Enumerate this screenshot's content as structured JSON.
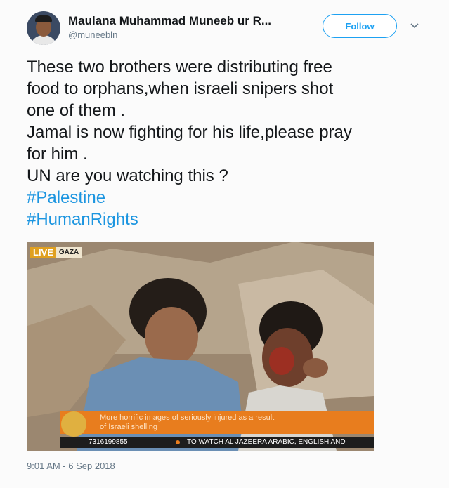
{
  "tweet": {
    "author_name": "Maulana Muhammad Muneeb ur R...",
    "handle": "@muneebln",
    "follow_label": "Follow",
    "lines": [
      "These two brothers were distributing free",
      "food to orphans,when israeli snipers shot",
      "one of them .",
      "Jamal is now fighting for his life,please pray",
      "for him .",
      "UN are you watching this ?"
    ],
    "hashtags": [
      "#Palestine",
      "#HumanRights"
    ],
    "timestamp": "9:01 AM - 6 Sep 2018"
  },
  "media": {
    "live_label": "LIVE",
    "location_label": "GAZA",
    "ticker_lines": [
      "More horrific images of seriously injured as a result",
      "of Israeli shelling"
    ],
    "phone_number": "7316199855",
    "bottom_message": "TO WATCH AL JAZEERA ARABIC, ENGLISH AND"
  },
  "colors": {
    "accent": "#1da1f2",
    "hashtag": "#1b95e0",
    "ticker": "#e87d1e"
  }
}
